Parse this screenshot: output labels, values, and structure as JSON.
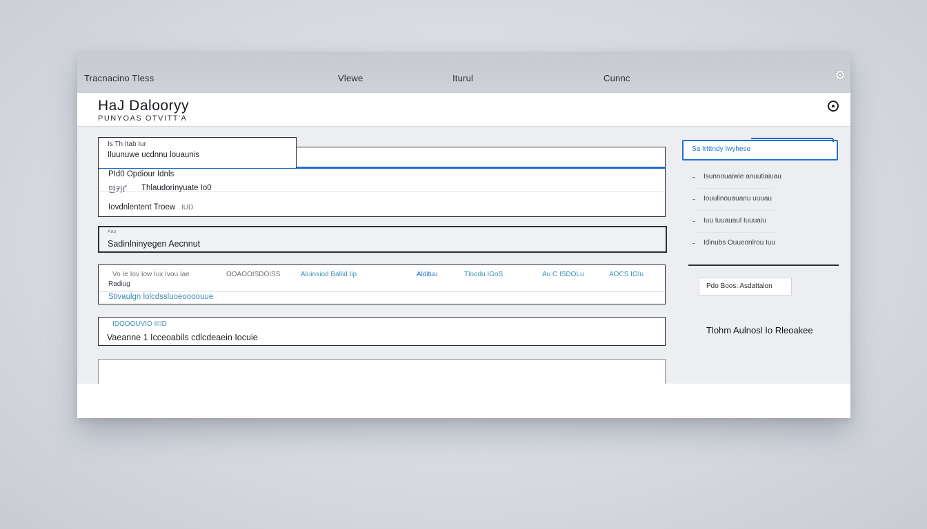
{
  "topbar": {
    "title": "Tracnacino Tless",
    "nav": [
      "Vlewe",
      "Iturul",
      "Cunnc"
    ]
  },
  "header": {
    "brand": "HaJ Dalooryy",
    "subtitle": "PUNYOAS OTVITT'A"
  },
  "card1": {
    "tab_kicker": "Is Th Itab Iur",
    "tab_title": "Iluunuwe ucdnnu louaunis",
    "row1": "PId0 Opdiour Idnls",
    "row2_icons": "먄카Ґ",
    "row2": "Thlaudorinyuate Io0",
    "row3": "Iovdnlentent Troew",
    "row3_trail": "IUD"
  },
  "card2": {
    "kicker": "Aau",
    "label": "Sadinlninyegen Aecnnut"
  },
  "card3": {
    "columns": [
      "Vo Ie Iov Iow Iux Ivou Iae",
      "OOAOOISDOISS",
      "Aluinsiod Ballid Iip",
      "Aldituu",
      "Tloodu IGoS",
      "Au C ISDOLu",
      "AOCS IOIu"
    ],
    "label": "Radiug",
    "value": "Stivaulgn lolcdssluoeoooouue"
  },
  "card4": {
    "kicker": "IDOOOUVIO IIIID",
    "value": "Vaeanne 1 Icceoabils cdlcdeaein Iocuie"
  },
  "sidebar": {
    "cta": "Sa Irtttndy Iwyheso",
    "items": [
      "Isunnouaiwie anuutiaiuau",
      "Iouulinouauanu uuuau",
      "Iuu Iuuauaul Iuuuaiu",
      "Idinubs Ouueonlrou Iuu"
    ],
    "chip": "Pdo Boos: Asdattalon",
    "footer": "Tlohm Aulnosl Io Rleoakee"
  },
  "colors": {
    "accent": "#1f6fcf",
    "teal": "#3c8fb3"
  },
  "icons": {
    "settings": "gear-icon",
    "account": "user-circle-icon"
  }
}
